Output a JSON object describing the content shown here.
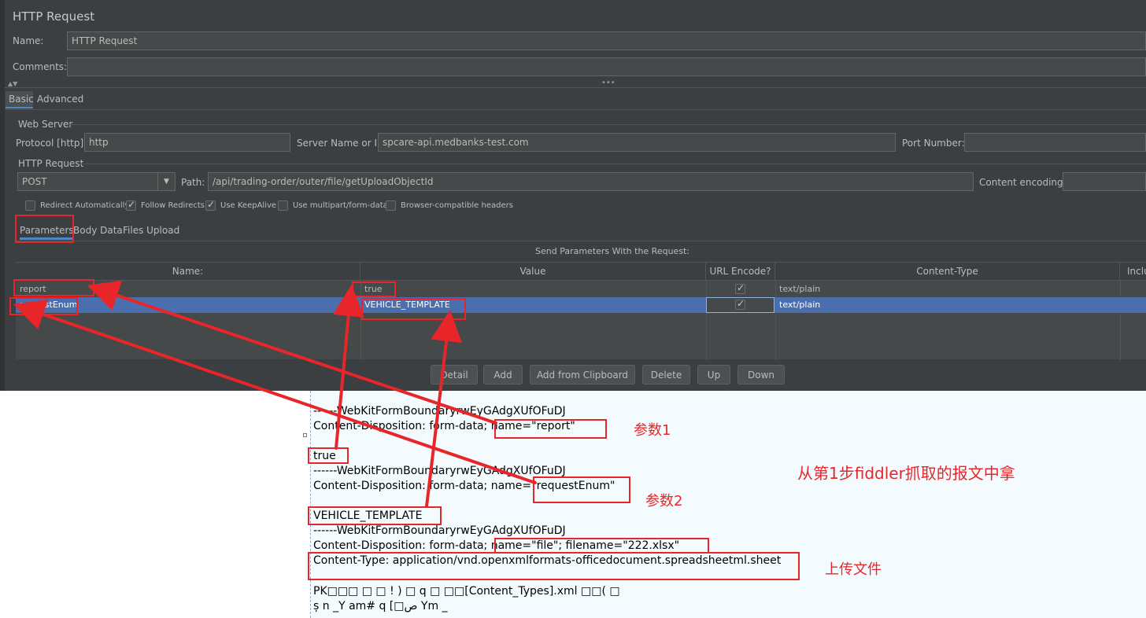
{
  "panel": {
    "title": "HTTP Request",
    "name_label": "Name:",
    "name_value": "HTTP Request",
    "comments_label": "Comments:",
    "comments_value": "",
    "tabs": [
      "Basic",
      "Advanced"
    ],
    "web_server": {
      "group_label": "Web Server",
      "protocol_label": "Protocol [http]:",
      "protocol_value": "http",
      "server_label": "Server Name or IP:",
      "server_value": "spcare-api.medbanks-test.com",
      "port_label": "Port Number:",
      "port_value": ""
    },
    "http_request": {
      "group_label": "HTTP Request",
      "method": "POST",
      "path_label": "Path:",
      "path_value": "/api/trading-order/outer/file/getUploadObjectId",
      "encoding_label": "Content encoding:",
      "encoding_value": ""
    },
    "checkboxes": [
      {
        "label": "Redirect Automatically",
        "checked": false
      },
      {
        "label": "Follow Redirects",
        "checked": true
      },
      {
        "label": "Use KeepAlive",
        "checked": true
      },
      {
        "label": "Use multipart/form-data",
        "checked": false
      },
      {
        "label": "Browser-compatible headers",
        "checked": false
      }
    ],
    "sub_tabs": [
      "Parameters",
      "Body Data",
      "Files Upload"
    ],
    "params_title": "Send Parameters With the Request:",
    "columns": [
      "Name:",
      "Value",
      "URL Encode?",
      "Content-Type",
      "Inclu"
    ],
    "rows": [
      {
        "name": "report",
        "value": "true",
        "url_encode": true,
        "content_type": "text/plain",
        "selected": false
      },
      {
        "name": "requestEnum",
        "value": "VEHICLE_TEMPLATE",
        "url_encode": true,
        "content_type": "text/plain",
        "selected": true
      }
    ],
    "buttons": [
      "Detail",
      "Add",
      "Add from Clipboard",
      "Delete",
      "Up",
      "Down"
    ]
  },
  "fiddler": {
    "lines": [
      "------WebKitFormBoundaryrwEyGAdgXUfOFuDJ",
      "Content-Disposition: form-data; name=\"report\"",
      "",
      "true",
      "------WebKitFormBoundaryrwEyGAdgXUfOFuDJ",
      "Content-Disposition: form-data; name=\"requestEnum\"",
      "",
      "VEHICLE_TEMPLATE",
      "------WebKitFormBoundaryrwEyGAdgXUfOFuDJ",
      "Content-Disposition: form-data; name=\"file\"; filename=\"222.xlsx\"",
      "Content-Type: application/vnd.openxmlformats-officedocument.spreadsheetml.sheet",
      "",
      "PK□□□ □ □  ! )   □  q   □ □□[Content_Types].xml  □□(  □",
      " ș n _Y   am# q [□ص Ym    _"
    ]
  },
  "annotations": {
    "param1": "参数1",
    "param2": "参数2",
    "source_note": "从第1步fiddler抓取的报文中拿",
    "upload": "上传文件"
  },
  "colors": {
    "panel_bg": "#3c3f41",
    "selection": "#4b6eaf",
    "annotation": "#e8262a",
    "tab_underline": "#4a88c7"
  }
}
